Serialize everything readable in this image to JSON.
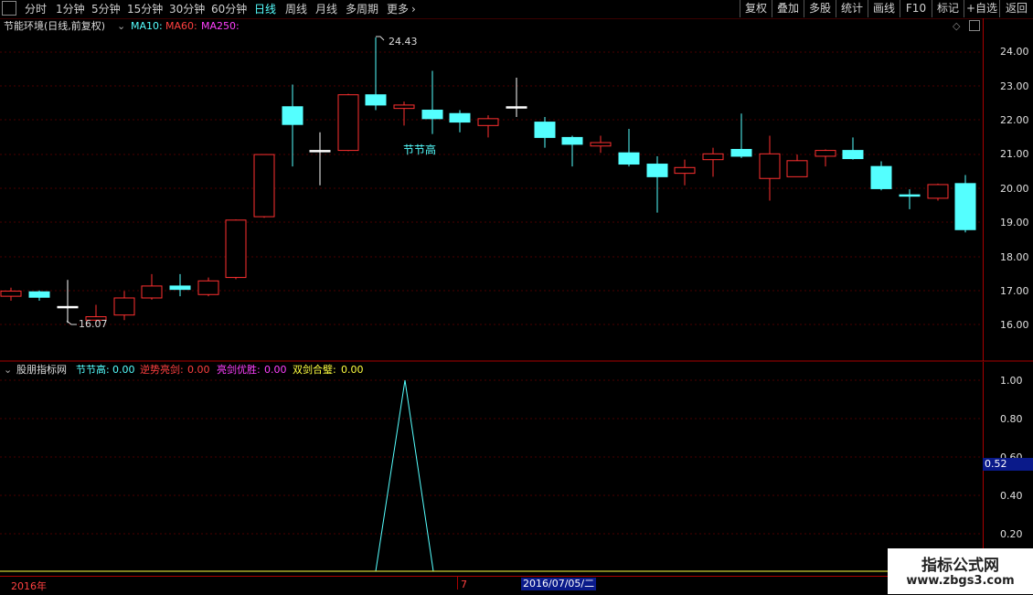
{
  "toolbar": {
    "left_items": [
      "分时",
      "1分钟",
      "5分钟",
      "15分钟",
      "30分钟",
      "60分钟",
      "日线",
      "周线",
      "月线",
      "多周期",
      "更多"
    ],
    "active_item": "日线",
    "right_buttons": [
      "复权",
      "叠加",
      "多股",
      "统计",
      "画线",
      "F10",
      "标记",
      "+自选",
      "返回"
    ]
  },
  "main_panel": {
    "title": "节能环境(日线,前复权)",
    "ma_labels": [
      {
        "label": "MA10:",
        "color": "#5ff"
      },
      {
        "label": "MA60:",
        "color": "#ff4040"
      },
      {
        "label": "MA250:",
        "color": "#ff40ff"
      }
    ],
    "high_label": "24.43",
    "low_label": "16.07",
    "annotation": "节节高",
    "y_ticks": [
      "24.00",
      "23.00",
      "22.00",
      "21.00",
      "20.00",
      "19.00",
      "18.00",
      "17.00",
      "16.00"
    ]
  },
  "indicator_panel": {
    "title": "股朋指标网",
    "values": [
      {
        "name": "节节高:",
        "value": "0.00",
        "color": "#5ff"
      },
      {
        "name": "逆势亮剑:",
        "value": "0.00",
        "color": "#ff4040"
      },
      {
        "name": "亮剑优胜:",
        "value": "0.00",
        "color": "#ff40ff"
      },
      {
        "name": "双剑合璧:",
        "value": "0.00",
        "color": "#ffff40"
      }
    ],
    "y_ticks": [
      "1.00",
      "0.80",
      "0.60",
      "0.40",
      "0.20"
    ],
    "cursor_value": "0.52"
  },
  "date_axis": {
    "year_label": "2016年",
    "month_label": "7",
    "cursor_date": "2016/07/05/二"
  },
  "watermark": {
    "line1": "指标公式网",
    "line2": "www.zbgs3.com"
  },
  "colors": {
    "up": "#ff3030",
    "down": "#54ffff",
    "grid": "#4a0000",
    "axis": "#aa0000"
  }
}
